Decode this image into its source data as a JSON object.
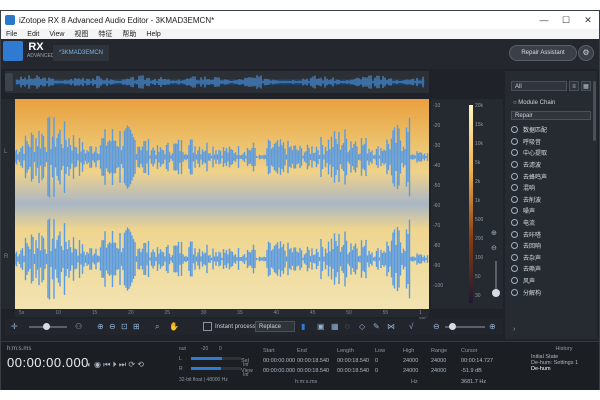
{
  "window": {
    "title": "iZotope RX 8 Advanced Audio Editor - 3KMAD3EMCN*",
    "controls": [
      "—",
      "☐",
      "✕"
    ]
  },
  "menu": [
    "File",
    "Edit",
    "View",
    "视图",
    "特征",
    "帮助",
    "Help"
  ],
  "toolbar": {
    "logo_text": "RX",
    "logo_sub": "ADVANCED",
    "file_tab": "*3KMAD3EMCN",
    "repair_button": "Repair Assistant"
  },
  "timeline": {
    "ticks": [
      "5s",
      "10",
      "15",
      "20",
      "25",
      "30",
      "35",
      "40",
      "45",
      "50",
      "55",
      "1 sec"
    ]
  },
  "amp_scale": [
    "-10",
    "-20",
    "-30",
    "-40",
    "-50",
    "-60",
    "-70",
    "-80",
    "-90",
    "-100"
  ],
  "freq_scale": [
    "20k",
    "15k",
    "10k",
    "5k",
    "2k",
    "1k",
    "500",
    "200",
    "100",
    "50",
    "30"
  ],
  "right_panel": {
    "filter": "All",
    "chain_label": "Module Chain",
    "preset": "Repair",
    "modules": [
      "数据匹配",
      "呼吸音",
      "中心提取",
      "去滤波",
      "去蜂鸣声",
      "混响",
      "去削波",
      "噪声",
      "电流",
      "去咔嗒",
      "去回响",
      "去杂声",
      "去嘶声",
      "风声",
      "分解构"
    ],
    "more_glyph": "›"
  },
  "bottom_toolbar": {
    "instant_process": "Instant process",
    "mode": "Replace"
  },
  "status": {
    "tc_label": "h:m:s.ms",
    "timecode": "00:00:00.000",
    "transport_glyphs": "◐ ◉ ⏮ ⏵ ⏭ ⟳ ⟲",
    "meter": {
      "header_l": "out",
      "header_m": "-20",
      "header_r": "0",
      "rows": [
        {
          "ch": "L",
          "level": 0.62,
          "db": "-Inf"
        },
        {
          "ch": "R",
          "level": 0.6,
          "db": "-Inf"
        }
      ],
      "footer": "32-bit float | 48000 Hz"
    },
    "table": {
      "headers": [
        "Start",
        "End",
        "Length",
        "Low",
        "High",
        "Range",
        "Cursor"
      ],
      "row_sel_label": "Sel",
      "row_view_label": "View",
      "sel": [
        "00:00:00.000",
        "00:00:18.540",
        "00:00:18.540",
        "0",
        "24000",
        "24000",
        "00:00:14.727"
      ],
      "view": [
        "00:00:00.000",
        "00:00:18.540",
        "00:00:18.540",
        "0",
        "24000",
        "24000",
        "-51.9 dB"
      ],
      "footer_left": "h:m:s.ms",
      "footer_right": "Hz",
      "cursor_extra": "3681.7 Hz"
    },
    "history": {
      "title": "History",
      "items": [
        "Initial State",
        "De-hum: Settings 1",
        "De-hum"
      ]
    }
  },
  "colors": {
    "accent": "#2e7bd1",
    "waveform": "#5b9be0",
    "panel": "#262b31",
    "spectro_warm": "#e9a03f"
  }
}
